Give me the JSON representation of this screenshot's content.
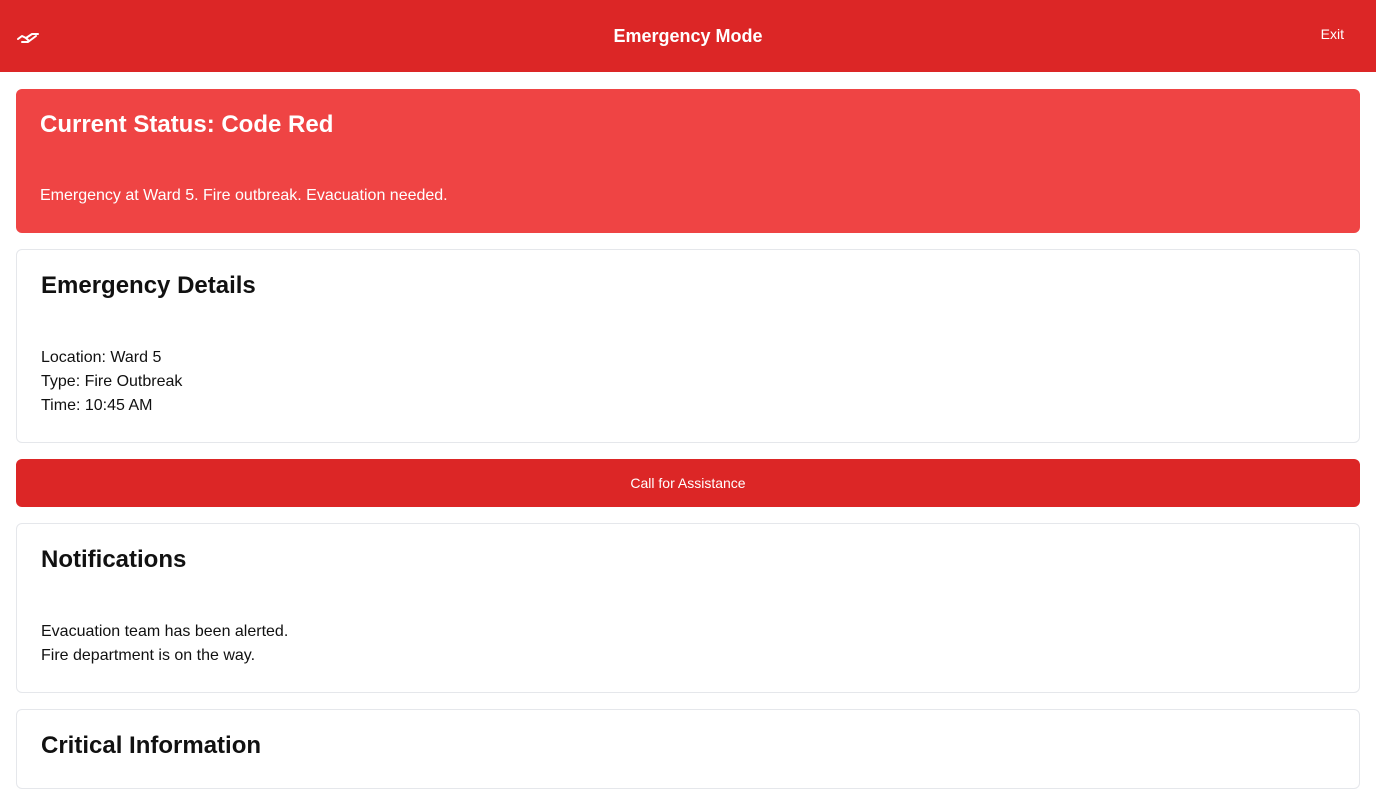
{
  "header": {
    "title": "Emergency Mode",
    "exit_label": "Exit",
    "logo_icon": "handshake-icon"
  },
  "status": {
    "title": "Current Status: Code Red",
    "message": "Emergency at Ward 5. Fire outbreak. Evacuation needed."
  },
  "details": {
    "title": "Emergency Details",
    "location": "Location: Ward 5",
    "type": "Type: Fire Outbreak",
    "time": "Time: 10:45 AM"
  },
  "assist_button_label": "Call for Assistance",
  "notifications": {
    "title": "Notifications",
    "items": [
      "Evacuation team has been alerted.",
      "Fire department is on the way."
    ]
  },
  "critical": {
    "title": "Critical Information"
  },
  "colors": {
    "header_red": "#dc2626",
    "status_red": "#ef4444"
  }
}
